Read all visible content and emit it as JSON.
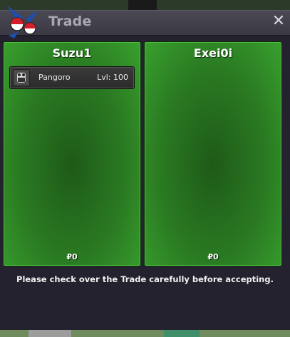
{
  "window": {
    "title": "Trade",
    "close_label": "✕"
  },
  "left_panel": {
    "player": "Suzu1",
    "items": [
      {
        "name": "Pangoro",
        "level": "Lvl: 100"
      }
    ],
    "money": "₽0"
  },
  "right_panel": {
    "player": "Exei0i",
    "money": "₽0"
  },
  "notice": "Please check over the Trade carefully before accepting.",
  "colors": {
    "panel_green": "#2a7a22",
    "window_bg": "#24222e",
    "titlebar": "#4a4852"
  },
  "icons": {
    "logo": "pokeball-logo-icon",
    "item": "pangoro-sprite-icon",
    "close": "close-icon"
  }
}
